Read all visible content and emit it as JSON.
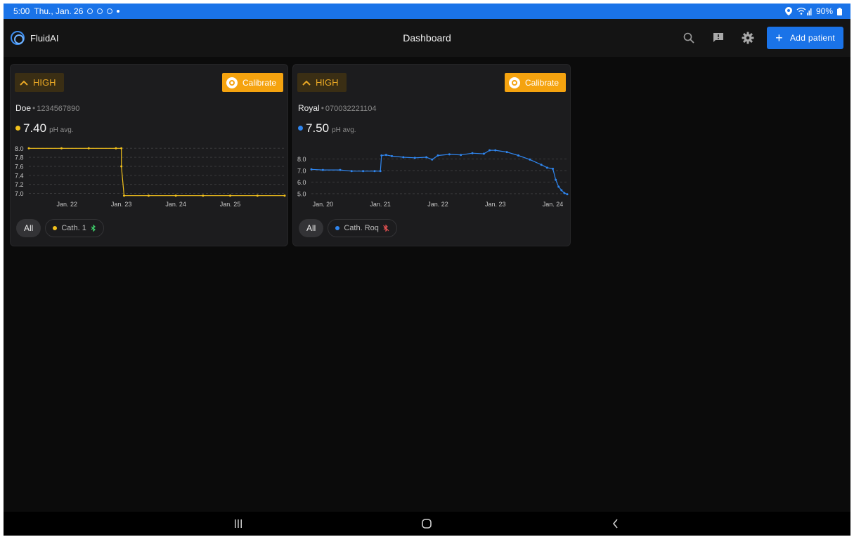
{
  "status": {
    "time": "5:00",
    "date": "Thu., Jan. 26",
    "battery": "90%"
  },
  "app": {
    "name": "FluidAI",
    "title": "Dashboard",
    "add_label": "Add patient"
  },
  "colors": {
    "accent": "#1a73e8",
    "warning": "#f5a30f",
    "series_yellow": "#f2c11c",
    "series_blue": "#2f86f0",
    "ble_on": "#3ecf6a",
    "ble_off": "#e05050"
  },
  "icons": {
    "search": "search-icon",
    "feedback": "feedback-icon",
    "settings": "gear-icon",
    "add": "plus-icon",
    "calibrate": "target-icon",
    "high": "chevron-up-icon",
    "bluetooth": "bluetooth-icon"
  },
  "cards": [
    {
      "level": "HIGH",
      "calibrate_label": "Calibrate",
      "patient_name": "Doe",
      "patient_id": "1234567890",
      "value": "7.40",
      "unit": "pH avg.",
      "chip_all": "All",
      "chip_series": "Cath. 1",
      "bluetooth_connected": true
    },
    {
      "level": "HIGH",
      "calibrate_label": "Calibrate",
      "patient_name": "Royal",
      "patient_id": "070032221104",
      "value": "7.50",
      "unit": "pH avg.",
      "chip_all": "All",
      "chip_series": "Cath. Roq",
      "bluetooth_connected": false
    }
  ],
  "chart_data": [
    {
      "type": "line",
      "x_ticks": [
        "Jan. 22",
        "Jan. 23",
        "Jan. 24",
        "Jan. 25"
      ],
      "y_ticks": [
        "8.0",
        "7.8",
        "7.6",
        "7.4",
        "7.2",
        "7.0"
      ],
      "ylim": [
        6.93,
        8.02
      ],
      "xlim": [
        21.3,
        26.0
      ],
      "grid": true,
      "series": [
        {
          "name": "Cath. 1",
          "color": "#f2c11c",
          "x": [
            21.3,
            21.9,
            22.4,
            22.9,
            23.0,
            23.0,
            23.05,
            23.5,
            24.0,
            24.5,
            25.0,
            25.5,
            26.0
          ],
          "y": [
            8.0,
            8.0,
            8.0,
            8.0,
            8.0,
            7.6,
            6.95,
            6.95,
            6.95,
            6.95,
            6.95,
            6.95,
            6.95
          ]
        }
      ]
    },
    {
      "type": "line",
      "x_ticks": [
        "Jan. 20",
        "Jan. 21",
        "Jan. 22",
        "Jan. 23",
        "Jan. 24"
      ],
      "y_ticks": [
        "8.0",
        "7.0",
        "6.0",
        "5.0"
      ],
      "ylim": [
        4.75,
        9.0
      ],
      "xlim": [
        19.8,
        24.25
      ],
      "grid": true,
      "series": [
        {
          "name": "Cath. Roq",
          "color": "#2f86f0",
          "x": [
            19.8,
            20.0,
            20.3,
            20.5,
            20.7,
            20.9,
            21.0,
            21.02,
            21.1,
            21.2,
            21.4,
            21.6,
            21.8,
            21.9,
            22.0,
            22.2,
            22.4,
            22.6,
            22.8,
            22.9,
            23.0,
            23.2,
            23.4,
            23.6,
            23.8,
            23.9,
            24.0,
            24.05,
            24.1,
            24.15,
            24.2,
            24.25
          ],
          "y": [
            7.1,
            7.05,
            7.05,
            6.95,
            6.95,
            6.95,
            6.95,
            8.3,
            8.35,
            8.25,
            8.15,
            8.1,
            8.15,
            7.95,
            8.3,
            8.4,
            8.35,
            8.5,
            8.45,
            8.75,
            8.75,
            8.6,
            8.3,
            7.95,
            7.5,
            7.25,
            7.15,
            6.2,
            5.6,
            5.3,
            5.05,
            4.95
          ]
        }
      ]
    }
  ]
}
